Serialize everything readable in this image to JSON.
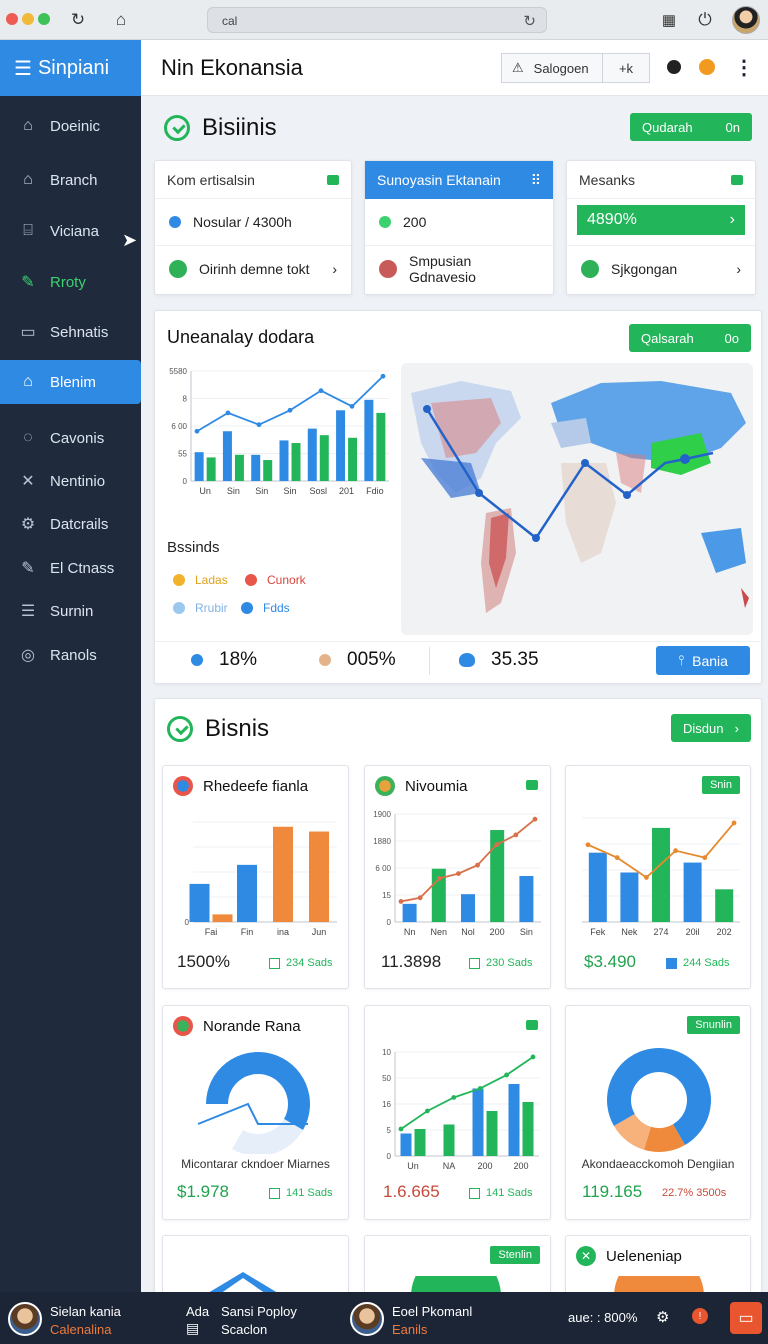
{
  "browser": {
    "url_text": "cal"
  },
  "sidebar": {
    "brand": "Sinpiani",
    "items": [
      {
        "label": "Doeinic",
        "icon": "home-icon"
      },
      {
        "label": "Branch",
        "icon": "building-icon"
      },
      {
        "label": "Viciana",
        "icon": "bank-icon"
      },
      {
        "label": "Rroty",
        "icon": "pencil-icon"
      },
      {
        "label": "Sehnatis",
        "icon": "square-icon"
      },
      {
        "label": "Blenim",
        "icon": "home-icon"
      },
      {
        "label": "Cavonis",
        "icon": "circle-icon"
      },
      {
        "label": "Nentinio",
        "icon": "close-icon"
      },
      {
        "label": "Datcrails",
        "icon": "gear-icon"
      },
      {
        "label": "El Ctnass",
        "icon": "pencil-icon"
      },
      {
        "label": "Surnin",
        "icon": "list-icon"
      },
      {
        "label": "Ranols",
        "icon": "circle-dot-icon"
      }
    ]
  },
  "header": {
    "title": "Nin Ekonansia",
    "btn1": "Salogoen",
    "btn2": "+k"
  },
  "section1": {
    "title": "Bisiinis",
    "button_label": "Qudarah",
    "button_value": "0n"
  },
  "cards": [
    {
      "title": "Kom ertisalsin",
      "row1": "Nosular / 4300h",
      "row2": "Oirinh demne tokt"
    },
    {
      "title": "Sunoyasin Ektanain",
      "row1": "200",
      "row2": "Smpusian Gdnavesio"
    },
    {
      "title": "Mesanks",
      "row1": "4890%",
      "row2": "Sjkgongan"
    }
  ],
  "panel": {
    "title": "Uneanalay dodara",
    "button_label": "Qalsarah",
    "button_value": "0o",
    "legend_title": "Bssinds",
    "legend": [
      {
        "label": "Ladas",
        "color": "#f2b22c"
      },
      {
        "label": "Cunork",
        "color": "#e8554a"
      },
      {
        "label": "Rrubir",
        "color": "#9cc7ef"
      },
      {
        "label": "Fdds",
        "color": "#2f8ae4"
      }
    ],
    "stats": [
      {
        "value": "18%",
        "color": "#2f8ae4"
      },
      {
        "value": "005%",
        "color": "#e3b48a"
      },
      {
        "value": "35.35",
        "color": "#2f8ae4"
      }
    ],
    "action_label": "Bania"
  },
  "chart_data": [
    {
      "type": "bar",
      "title": "",
      "categories": [
        "Un",
        "Sin",
        "Sin",
        "Sin",
        "Sosl",
        "201",
        "Fdio"
      ],
      "series": [
        {
          "values": [
            110,
            190,
            100,
            155,
            200,
            270,
            310
          ]
        },
        {
          "values": [
            90,
            100,
            80,
            145,
            175,
            165,
            260
          ]
        }
      ],
      "overlay_line": [
        190,
        260,
        215,
        270,
        345,
        285,
        400
      ],
      "yticks": [
        "5580",
        "8",
        "6 00",
        "55",
        "0"
      ]
    },
    {
      "type": "bar",
      "title": "Rhedeefe fianla",
      "categories": [
        "Fai",
        "Fin",
        "ina",
        "Jun"
      ],
      "series": [
        {
          "name": "blue",
          "values": [
            40,
            60,
            0,
            0
          ]
        },
        {
          "name": "orange",
          "values": [
            8,
            0,
            100,
            95
          ]
        }
      ],
      "yticks": [
        "0"
      ]
    },
    {
      "type": "bar",
      "title": "Nivoumia",
      "categories": [
        "Nn",
        "Nen",
        "Nol",
        "200",
        "Sin"
      ],
      "yticks": [
        "1900",
        "1880",
        "6 00",
        "15",
        "0"
      ],
      "series": [
        {
          "name": "blue",
          "values": [
            150,
            0,
            230,
            0,
            380
          ]
        },
        {
          "name": "green",
          "values": [
            0,
            440,
            0,
            760,
            0
          ]
        }
      ],
      "overlay_line": [
        170,
        200,
        360,
        400,
        470,
        640,
        720,
        850
      ]
    },
    {
      "type": "bar",
      "title": "",
      "categories": [
        "Fek",
        "Nek",
        "274",
        "20il",
        "202"
      ],
      "series": [
        {
          "name": "blue",
          "values": [
            70,
            50,
            0,
            60,
            0
          ]
        },
        {
          "name": "green",
          "values": [
            0,
            0,
            95,
            0,
            33
          ]
        }
      ],
      "overlay_line": [
        78,
        65,
        45,
        72,
        65,
        100
      ]
    },
    {
      "type": "pie",
      "title": "Norande Rana",
      "values": [
        70,
        30
      ]
    },
    {
      "type": "bar",
      "title": "",
      "categories": [
        "Un",
        "NA",
        "200",
        "200"
      ],
      "yticks": [
        "10",
        "50",
        "16",
        "5",
        "0"
      ],
      "series": [
        {
          "name": "blue",
          "values": [
            5,
            0,
            15,
            16
          ]
        },
        {
          "name": "green",
          "values": [
            6,
            7,
            10,
            12
          ]
        }
      ],
      "overlay_line": [
        6,
        10,
        13,
        15,
        18,
        22
      ]
    },
    {
      "type": "pie",
      "title": "",
      "values": [
        75,
        13,
        12
      ]
    }
  ],
  "section2": {
    "title": "Bisnis",
    "button_label": "Disdun",
    "chart_cards": [
      {
        "title": "Rhedeefe fianla",
        "value": "1500%",
        "sub": "234 Sads"
      },
      {
        "title": "Nivoumia",
        "value": "11.3898",
        "sub": "230 Sads"
      },
      {
        "badge": "Snin",
        "value": "$3.490",
        "sub": "244 Sads"
      },
      {
        "title": "Norande Rana",
        "caption": "Micontarar ckndoer Miarnes",
        "value": "$1.978",
        "sub": "141 Sads"
      },
      {
        "value": "1.6.665",
        "sub": "141 Sads"
      },
      {
        "badge": "Snunlin",
        "caption": "Akondaeacckomoh Dengiian",
        "value": "119.165",
        "sub": "22.7% 3500s"
      }
    ],
    "bottom_badge": "Stenlin",
    "bottom_card_title": "Ueleneniap"
  },
  "bottombar": {
    "user1_name": "Sielan kania",
    "user1_sub": "Calenalina",
    "mid_prefix": "Ada",
    "mid_title": "Sansi Poploy",
    "mid_sub": "Scaclon",
    "user2_name": "Eoel Pkomanl",
    "user2_sub": "Eanils",
    "status": "aue: : 800%"
  }
}
